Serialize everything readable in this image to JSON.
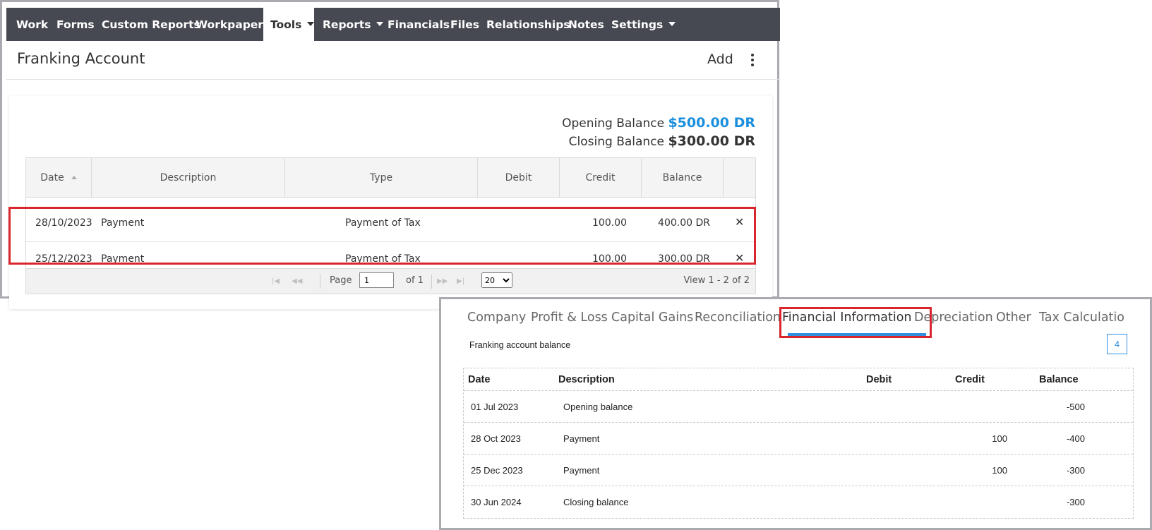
{
  "nav": {
    "items": [
      {
        "label": "Work"
      },
      {
        "label": "Forms"
      },
      {
        "label": "Custom Reports"
      },
      {
        "label": "Workpapers"
      },
      {
        "label": "Tools"
      },
      {
        "label": "Reports"
      },
      {
        "label": "Financials"
      },
      {
        "label": "Files"
      },
      {
        "label": "Relationships"
      },
      {
        "label": "Notes"
      },
      {
        "label": "Settings"
      }
    ],
    "active": "Tools"
  },
  "page": {
    "title": "Franking Account",
    "add_label": "Add"
  },
  "balances": {
    "opening_label": "Opening Balance",
    "opening_value": "$500.00 DR",
    "closing_label": "Closing Balance",
    "closing_value": "$300.00 DR",
    "opening_color": "#1a8fe0"
  },
  "grid": {
    "columns": [
      "Date",
      "Description",
      "Type",
      "Debit",
      "Credit",
      "Balance"
    ],
    "rows": [
      {
        "date": "28/10/2023",
        "description": "Payment",
        "type": "Payment of Tax",
        "debit": "",
        "credit": "100.00",
        "balance": "400.00 DR"
      },
      {
        "date": "25/12/2023",
        "description": "Payment",
        "type": "Payment of Tax",
        "debit": "",
        "credit": "100.00",
        "balance": "300.00 DR"
      }
    ],
    "pager": {
      "page_label": "Page",
      "page_value": "1",
      "of_label": "of 1",
      "rows_per_page": "20",
      "view_text": "View 1 - 2 of 2"
    }
  },
  "report": {
    "tabs": [
      {
        "label": "Company"
      },
      {
        "label": "Profit & Loss"
      },
      {
        "label": "Capital Gains"
      },
      {
        "label": "Reconciliation"
      },
      {
        "label": "Financial Information"
      },
      {
        "label": "Depreciation"
      },
      {
        "label": "Other"
      },
      {
        "label": "Tax Calculatio"
      }
    ],
    "active_tab": "Financial Information",
    "section_label": "Franking account balance",
    "count": "4",
    "columns": [
      "Date",
      "Description",
      "Debit",
      "Credit",
      "Balance"
    ],
    "rows": [
      {
        "date": "01 Jul 2023",
        "description": "Opening balance",
        "debit": "",
        "credit": "",
        "balance": "-500"
      },
      {
        "date": "28 Oct 2023",
        "description": "Payment",
        "debit": "",
        "credit": "100",
        "balance": "-400"
      },
      {
        "date": "25 Dec 2023",
        "description": "Payment",
        "debit": "",
        "credit": "100",
        "balance": "-300"
      },
      {
        "date": "30 Jun 2024",
        "description": "Closing balance",
        "debit": "",
        "credit": "",
        "balance": "-300"
      }
    ]
  },
  "colors": {
    "nav_bg": "#474952",
    "highlight": "#d9262d",
    "accent": "#2f8fe0"
  }
}
